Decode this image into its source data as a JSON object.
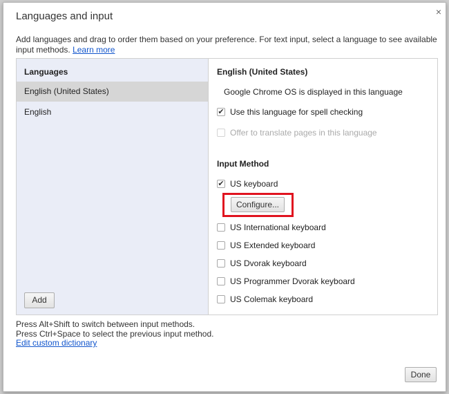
{
  "dialog": {
    "title": "Languages and input",
    "close_icon": "×",
    "description": "Add languages and drag to order them based on your preference. For text input, select a language to see available input methods.",
    "learn_more": "Learn more"
  },
  "languages": {
    "header": "Languages",
    "items": [
      {
        "label": "English (United States)",
        "selected": true
      },
      {
        "label": "English",
        "selected": false
      }
    ],
    "add_label": "Add"
  },
  "detail": {
    "title": "English (United States)",
    "display_note": "Google Chrome OS is displayed in this language",
    "spell_check": {
      "label": "Use this language for spell checking",
      "checked": true
    },
    "translate": {
      "label": "Offer to translate pages in this language",
      "checked": false,
      "disabled": true
    },
    "input_method_header": "Input Method",
    "methods": [
      {
        "label": "US keyboard",
        "checked": true
      },
      {
        "label": "US International keyboard",
        "checked": false
      },
      {
        "label": "US Extended keyboard",
        "checked": false
      },
      {
        "label": "US Dvorak keyboard",
        "checked": false
      },
      {
        "label": "US Programmer Dvorak keyboard",
        "checked": false
      },
      {
        "label": "US Colemak keyboard",
        "checked": false
      }
    ],
    "configure_label": "Configure..."
  },
  "footer": {
    "line1": "Press Alt+Shift to switch between input methods.",
    "line2": "Press Ctrl+Space to select the previous input method.",
    "edit_dictionary": "Edit custom dictionary",
    "done_label": "Done"
  },
  "check_mark": "✔"
}
